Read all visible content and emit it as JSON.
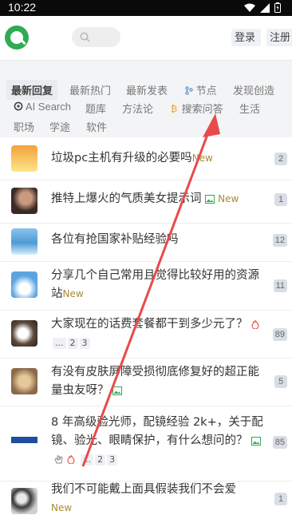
{
  "status_bar": {
    "time": "10:22"
  },
  "header": {
    "login_label": "登录",
    "register_label": "注册"
  },
  "tabs": {
    "row1": [
      "最新回复",
      "最新热门",
      "最新发表",
      "节点",
      "发现创造"
    ],
    "row2": [
      "AI Search",
      "题库",
      "方法论",
      "搜索问答",
      "生活"
    ],
    "row3": [
      "职场",
      "学途",
      "软件"
    ]
  },
  "topics": [
    {
      "title": "垃圾pc主机有升级的必要吗",
      "new": "New",
      "replies": "2"
    },
    {
      "title": "推特上爆火的气质美女提示词",
      "new": "New",
      "replies": "1"
    },
    {
      "title": "各位有抢国家补贴经验吗",
      "replies": "12"
    },
    {
      "title": "分享几个自己常用且觉得比较好用的资源站",
      "new": "New",
      "replies": "11"
    },
    {
      "title": "大家现在的话费套餐都干到多少元了？",
      "pages": [
        "...",
        "2",
        "3"
      ],
      "replies": "89"
    },
    {
      "title": "有没有皮肤屏障受损彻底修复好的超正能量虫友呀？",
      "replies": "5"
    },
    {
      "title": "8 年高级验光师，配镜经验 2k+，关于配镜、验光、眼睛保护，有什么想问的？",
      "pages": [
        "...",
        "2",
        "3"
      ],
      "replies": "85"
    },
    {
      "title": "我们不可能戴上面具假装我们不会爱",
      "new": "New",
      "replies": "1"
    }
  ],
  "colors": {
    "brand_green": "#2fab52",
    "new_tag": "#a68b3a",
    "annotation_arrow": "#e84a4a"
  }
}
